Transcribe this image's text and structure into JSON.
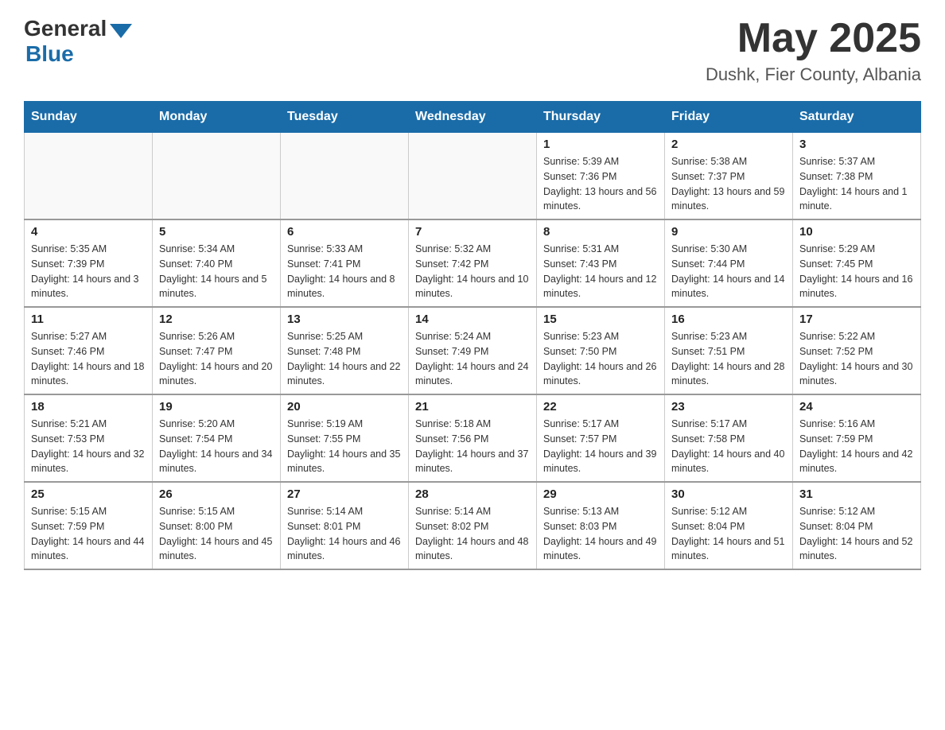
{
  "logo": {
    "general": "General",
    "blue": "Blue"
  },
  "title": {
    "month_year": "May 2025",
    "location": "Dushk, Fier County, Albania"
  },
  "days_of_week": [
    "Sunday",
    "Monday",
    "Tuesday",
    "Wednesday",
    "Thursday",
    "Friday",
    "Saturday"
  ],
  "weeks": [
    [
      {
        "day": "",
        "info": ""
      },
      {
        "day": "",
        "info": ""
      },
      {
        "day": "",
        "info": ""
      },
      {
        "day": "",
        "info": ""
      },
      {
        "day": "1",
        "info": "Sunrise: 5:39 AM\nSunset: 7:36 PM\nDaylight: 13 hours and 56 minutes."
      },
      {
        "day": "2",
        "info": "Sunrise: 5:38 AM\nSunset: 7:37 PM\nDaylight: 13 hours and 59 minutes."
      },
      {
        "day": "3",
        "info": "Sunrise: 5:37 AM\nSunset: 7:38 PM\nDaylight: 14 hours and 1 minute."
      }
    ],
    [
      {
        "day": "4",
        "info": "Sunrise: 5:35 AM\nSunset: 7:39 PM\nDaylight: 14 hours and 3 minutes."
      },
      {
        "day": "5",
        "info": "Sunrise: 5:34 AM\nSunset: 7:40 PM\nDaylight: 14 hours and 5 minutes."
      },
      {
        "day": "6",
        "info": "Sunrise: 5:33 AM\nSunset: 7:41 PM\nDaylight: 14 hours and 8 minutes."
      },
      {
        "day": "7",
        "info": "Sunrise: 5:32 AM\nSunset: 7:42 PM\nDaylight: 14 hours and 10 minutes."
      },
      {
        "day": "8",
        "info": "Sunrise: 5:31 AM\nSunset: 7:43 PM\nDaylight: 14 hours and 12 minutes."
      },
      {
        "day": "9",
        "info": "Sunrise: 5:30 AM\nSunset: 7:44 PM\nDaylight: 14 hours and 14 minutes."
      },
      {
        "day": "10",
        "info": "Sunrise: 5:29 AM\nSunset: 7:45 PM\nDaylight: 14 hours and 16 minutes."
      }
    ],
    [
      {
        "day": "11",
        "info": "Sunrise: 5:27 AM\nSunset: 7:46 PM\nDaylight: 14 hours and 18 minutes."
      },
      {
        "day": "12",
        "info": "Sunrise: 5:26 AM\nSunset: 7:47 PM\nDaylight: 14 hours and 20 minutes."
      },
      {
        "day": "13",
        "info": "Sunrise: 5:25 AM\nSunset: 7:48 PM\nDaylight: 14 hours and 22 minutes."
      },
      {
        "day": "14",
        "info": "Sunrise: 5:24 AM\nSunset: 7:49 PM\nDaylight: 14 hours and 24 minutes."
      },
      {
        "day": "15",
        "info": "Sunrise: 5:23 AM\nSunset: 7:50 PM\nDaylight: 14 hours and 26 minutes."
      },
      {
        "day": "16",
        "info": "Sunrise: 5:23 AM\nSunset: 7:51 PM\nDaylight: 14 hours and 28 minutes."
      },
      {
        "day": "17",
        "info": "Sunrise: 5:22 AM\nSunset: 7:52 PM\nDaylight: 14 hours and 30 minutes."
      }
    ],
    [
      {
        "day": "18",
        "info": "Sunrise: 5:21 AM\nSunset: 7:53 PM\nDaylight: 14 hours and 32 minutes."
      },
      {
        "day": "19",
        "info": "Sunrise: 5:20 AM\nSunset: 7:54 PM\nDaylight: 14 hours and 34 minutes."
      },
      {
        "day": "20",
        "info": "Sunrise: 5:19 AM\nSunset: 7:55 PM\nDaylight: 14 hours and 35 minutes."
      },
      {
        "day": "21",
        "info": "Sunrise: 5:18 AM\nSunset: 7:56 PM\nDaylight: 14 hours and 37 minutes."
      },
      {
        "day": "22",
        "info": "Sunrise: 5:17 AM\nSunset: 7:57 PM\nDaylight: 14 hours and 39 minutes."
      },
      {
        "day": "23",
        "info": "Sunrise: 5:17 AM\nSunset: 7:58 PM\nDaylight: 14 hours and 40 minutes."
      },
      {
        "day": "24",
        "info": "Sunrise: 5:16 AM\nSunset: 7:59 PM\nDaylight: 14 hours and 42 minutes."
      }
    ],
    [
      {
        "day": "25",
        "info": "Sunrise: 5:15 AM\nSunset: 7:59 PM\nDaylight: 14 hours and 44 minutes."
      },
      {
        "day": "26",
        "info": "Sunrise: 5:15 AM\nSunset: 8:00 PM\nDaylight: 14 hours and 45 minutes."
      },
      {
        "day": "27",
        "info": "Sunrise: 5:14 AM\nSunset: 8:01 PM\nDaylight: 14 hours and 46 minutes."
      },
      {
        "day": "28",
        "info": "Sunrise: 5:14 AM\nSunset: 8:02 PM\nDaylight: 14 hours and 48 minutes."
      },
      {
        "day": "29",
        "info": "Sunrise: 5:13 AM\nSunset: 8:03 PM\nDaylight: 14 hours and 49 minutes."
      },
      {
        "day": "30",
        "info": "Sunrise: 5:12 AM\nSunset: 8:04 PM\nDaylight: 14 hours and 51 minutes."
      },
      {
        "day": "31",
        "info": "Sunrise: 5:12 AM\nSunset: 8:04 PM\nDaylight: 14 hours and 52 minutes."
      }
    ]
  ]
}
